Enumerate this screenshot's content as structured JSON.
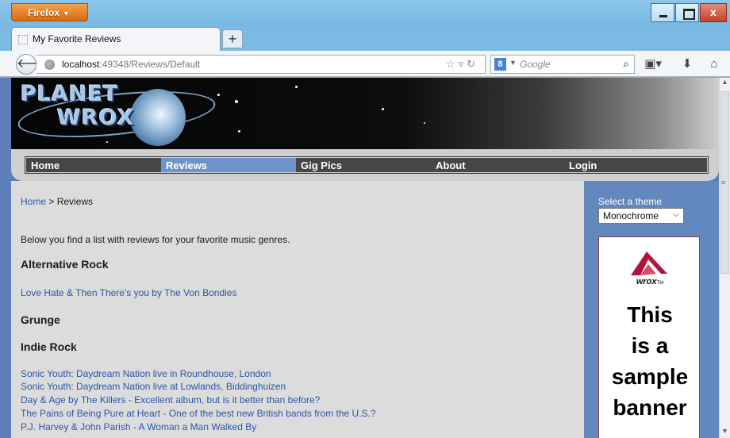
{
  "browser": {
    "menu_button": "Firefox",
    "tab_title": "My Favorite Reviews",
    "new_tab": "+",
    "url_host": "localhost",
    "url_path": ":49348/Reviews/Default",
    "search_placeholder": "Google",
    "search_engine_letter": "8"
  },
  "site": {
    "logo_line1": "PLANET",
    "logo_line2": "WROX",
    "menu": [
      {
        "label": "Home",
        "active": false
      },
      {
        "label": "Reviews",
        "active": true
      },
      {
        "label": "Gig Pics",
        "active": false
      },
      {
        "label": "About",
        "active": false
      },
      {
        "label": "Login",
        "active": false
      }
    ]
  },
  "content": {
    "breadcrumb_home": "Home",
    "breadcrumb_sep": " > ",
    "breadcrumb_current": "Reviews",
    "intro": "Below you find a list with reviews for your favorite music genres.",
    "genres": [
      {
        "name": "Alternative Rock",
        "reviews": [
          "Love Hate & Then There's you by The Von Bondies"
        ]
      },
      {
        "name": "Grunge",
        "reviews": []
      },
      {
        "name": "Indie Rock",
        "reviews": [
          "Sonic Youth: Daydream Nation live in Roundhouse, London",
          "Sonic Youth: Daydream Nation live at Lowlands, Biddinghuizen",
          "Day & Age by The Killers - Excellent album, but is it better than before?",
          "The Pains of Being Pure at Heart - One of the best new British bands from the U.S.?",
          "P.J. Harvey & John Parish - A Woman a Man Walked By"
        ]
      }
    ]
  },
  "sidebar": {
    "theme_label": "Select a theme",
    "theme_value": "Monochrome",
    "ad_brand": "wrox",
    "ad_brand_tm": "TM",
    "ad_lines": [
      "This",
      "is a",
      "sample",
      "banner"
    ]
  },
  "colors": {
    "accent": "#6388bf",
    "menu_active": "#6e93c8",
    "link": "#2a56a7"
  }
}
